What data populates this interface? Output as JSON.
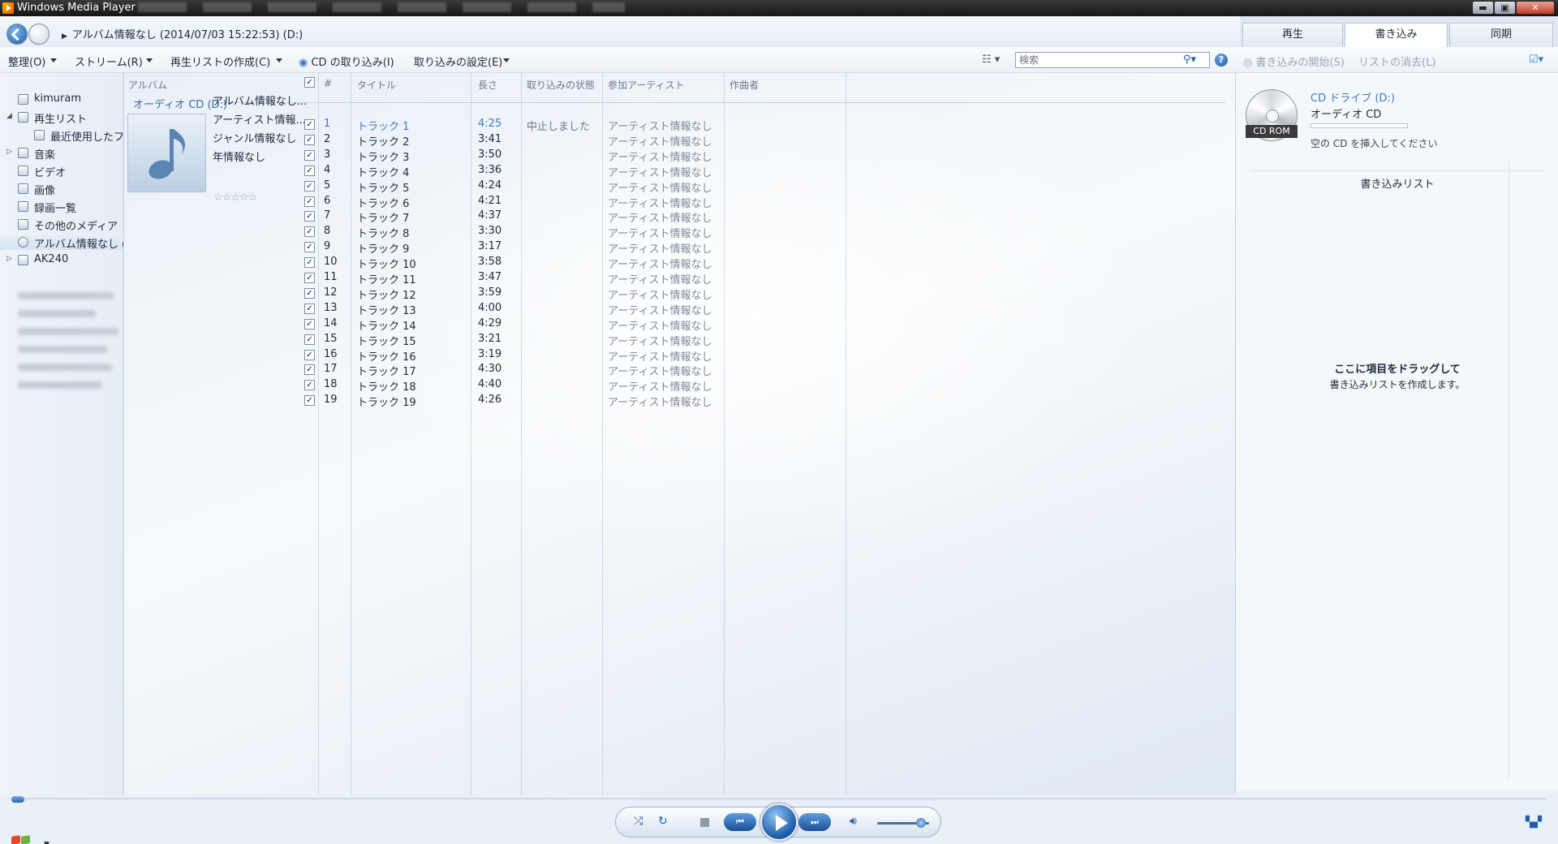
{
  "window": {
    "title": "Windows Media Player",
    "min_label": "▬",
    "max_label": "▣",
    "close_label": "✕"
  },
  "nav": {
    "breadcrumb": "アルバム情報なし (2014/07/03 15:22:53) (D:)"
  },
  "tabs": [
    {
      "label": "再生"
    },
    {
      "label": "書き込み"
    },
    {
      "label": "同期"
    }
  ],
  "toolbar": {
    "organize": "整理(O)",
    "stream": "ストリーム(R)",
    "create_playlist": "再生リストの作成(C)",
    "rip_cd": "CD の取り込み(I)",
    "rip_settings": "取り込みの設定(E)",
    "search_placeholder": "検索"
  },
  "burn_toolbar": {
    "start_burn": "書き込みの開始(S)",
    "clear_list": "リストの消去(L)"
  },
  "navpane": {
    "items": [
      {
        "label": "kimuram"
      },
      {
        "label": "再生リスト"
      },
      {
        "label": "最近使用したフ:"
      },
      {
        "label": "音楽"
      },
      {
        "label": "ビデオ"
      },
      {
        "label": "画像"
      },
      {
        "label": "録画一覧"
      },
      {
        "label": "その他のメディア"
      },
      {
        "label": "アルバム情報なし (:"
      },
      {
        "label": "AK240"
      }
    ]
  },
  "columns": {
    "album": "アルバム",
    "number": "#",
    "title": "タイトル",
    "length": "長さ",
    "rip_status": "取り込みの状態",
    "contributing_artist": "参加アーティスト",
    "composer": "作曲者"
  },
  "album": {
    "group_header": "オーディオ CD (D:)",
    "name": "アルバム情報なし...",
    "artist": "アーティスト情報...",
    "genre": "ジャンル情報なし",
    "year": "年情報なし",
    "rating_stars": 0
  },
  "tracks": [
    {
      "num": "1",
      "title": "トラック 1",
      "length": "4:25",
      "status": "中止しました",
      "artist": "アーティスト情報なし"
    },
    {
      "num": "2",
      "title": "トラック 2",
      "length": "3:41",
      "status": "",
      "artist": "アーティスト情報なし"
    },
    {
      "num": "3",
      "title": "トラック 3",
      "length": "3:50",
      "status": "",
      "artist": "アーティスト情報なし"
    },
    {
      "num": "4",
      "title": "トラック 4",
      "length": "3:36",
      "status": "",
      "artist": "アーティスト情報なし"
    },
    {
      "num": "5",
      "title": "トラック 5",
      "length": "4:24",
      "status": "",
      "artist": "アーティスト情報なし"
    },
    {
      "num": "6",
      "title": "トラック 6",
      "length": "4:21",
      "status": "",
      "artist": "アーティスト情報なし"
    },
    {
      "num": "7",
      "title": "トラック 7",
      "length": "4:37",
      "status": "",
      "artist": "アーティスト情報なし"
    },
    {
      "num": "8",
      "title": "トラック 8",
      "length": "3:30",
      "status": "",
      "artist": "アーティスト情報なし"
    },
    {
      "num": "9",
      "title": "トラック 9",
      "length": "3:17",
      "status": "",
      "artist": "アーティスト情報なし"
    },
    {
      "num": "10",
      "title": "トラック 10",
      "length": "3:58",
      "status": "",
      "artist": "アーティスト情報なし"
    },
    {
      "num": "11",
      "title": "トラック 11",
      "length": "3:47",
      "status": "",
      "artist": "アーティスト情報なし"
    },
    {
      "num": "12",
      "title": "トラック 12",
      "length": "3:59",
      "status": "",
      "artist": "アーティスト情報なし"
    },
    {
      "num": "13",
      "title": "トラック 13",
      "length": "4:00",
      "status": "",
      "artist": "アーティスト情報なし"
    },
    {
      "num": "14",
      "title": "トラック 14",
      "length": "4:29",
      "status": "",
      "artist": "アーティスト情報なし"
    },
    {
      "num": "15",
      "title": "トラック 15",
      "length": "3:21",
      "status": "",
      "artist": "アーティスト情報なし"
    },
    {
      "num": "16",
      "title": "トラック 16",
      "length": "3:19",
      "status": "",
      "artist": "アーティスト情報なし"
    },
    {
      "num": "17",
      "title": "トラック 17",
      "length": "4:30",
      "status": "",
      "artist": "アーティスト情報なし"
    },
    {
      "num": "18",
      "title": "トラック 18",
      "length": "4:40",
      "status": "",
      "artist": "アーティスト情報なし"
    },
    {
      "num": "19",
      "title": "トラック 19",
      "length": "4:26",
      "status": "",
      "artist": "アーティスト情報なし"
    }
  ],
  "burn": {
    "drive_name": "CD ドライブ (D:)",
    "drive_type": "オーディオ CD",
    "cd_label": "CD ROM",
    "insert_hint": "空の CD を挿入してください",
    "list_title": "書き込みリスト",
    "drop_line1": "ここに項目をドラッグして",
    "drop_line2": "書き込みリストを作成します。"
  },
  "player": {
    "shuffle_icon": "shuffle-icon",
    "repeat_icon": "repeat-icon",
    "prev_label": "⏮",
    "next_label": "⏭",
    "volume_level": 0.85,
    "seek_position": 0
  },
  "colors": {
    "accent": "#1d5fa8",
    "link": "#3f79c2",
    "close_red": "#c23a24"
  }
}
